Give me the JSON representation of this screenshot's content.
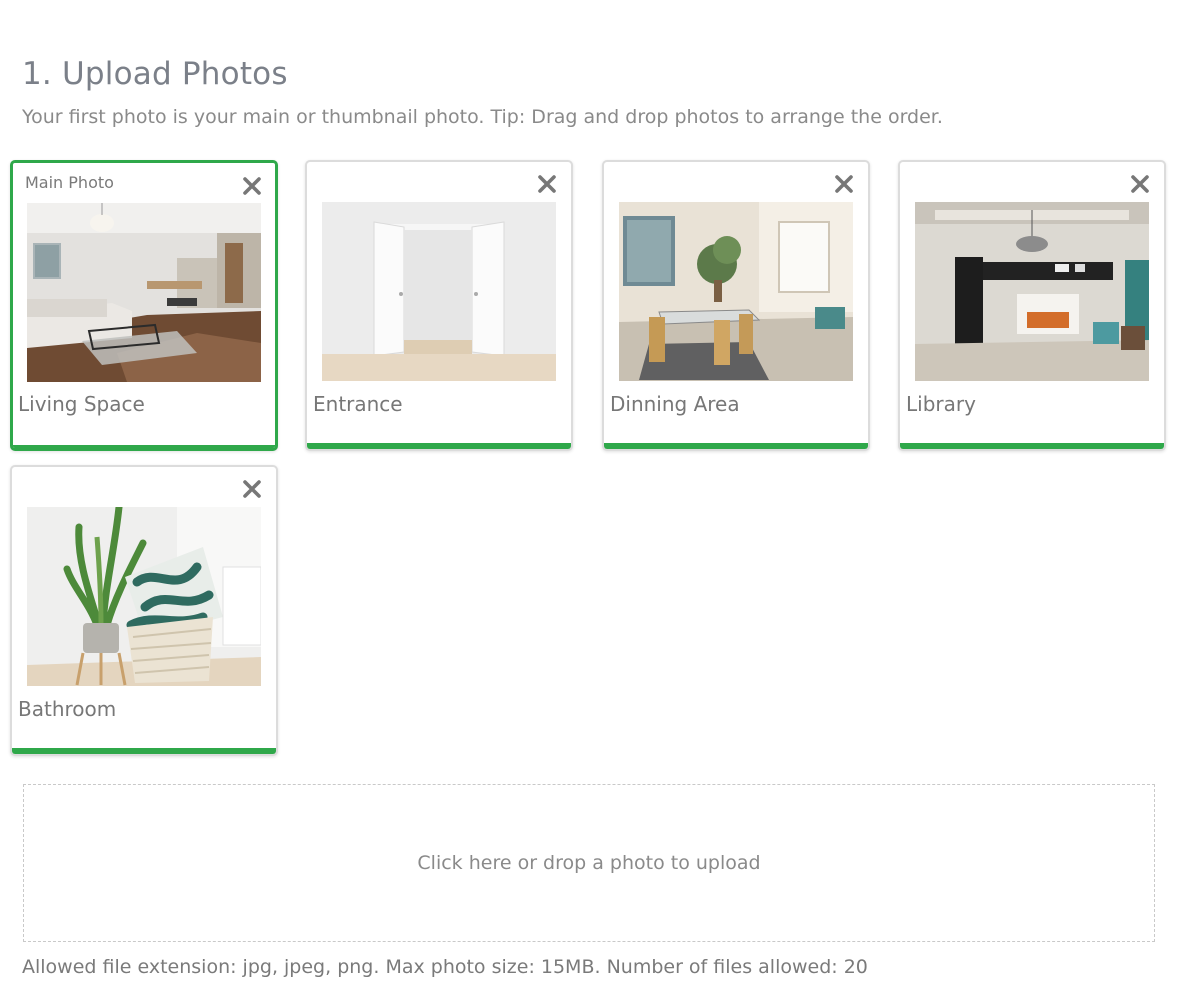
{
  "section": {
    "title": "1. Upload Photos",
    "subtitle": "Your first photo is your main or thumbnail photo. Tip: Drag and drop photos to arrange the order."
  },
  "main_photo_label": "Main Photo",
  "close_icon": "close-icon",
  "accent_color": "#2fa84a",
  "photos": [
    {
      "caption": "Living Space",
      "is_main": true,
      "upload_progress": 1.0
    },
    {
      "caption": "Entrance",
      "is_main": false,
      "upload_progress": 1.0
    },
    {
      "caption": "Dinning Area",
      "is_main": false,
      "upload_progress": 1.0
    },
    {
      "caption": "Library",
      "is_main": false,
      "upload_progress": 1.0
    },
    {
      "caption": "Bathroom",
      "is_main": false,
      "upload_progress": 1.0
    }
  ],
  "dropzone": {
    "label": "Click here or drop a photo to upload"
  },
  "footnote": "Allowed file extension: jpg, jpeg, png. Max photo size: 15MB. Number of files allowed: 20"
}
